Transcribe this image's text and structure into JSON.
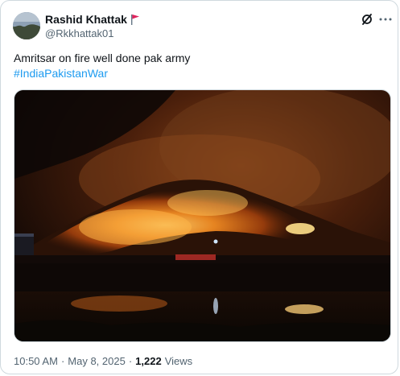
{
  "author": {
    "display_name": "Rashid Khattak",
    "handle": "@Rkkhattak01",
    "badge_icon": "red-flag-icon"
  },
  "header_actions": {
    "grok_icon": "grok-icon",
    "more_icon": "more-icon"
  },
  "tweet": {
    "text": "Amritsar on fire well done pak army",
    "hashtag": "#IndiaPakistanWar"
  },
  "media": {
    "description_icon": "photo"
  },
  "meta": {
    "time": "10:50 AM",
    "separator": "·",
    "date": "May 8, 2025",
    "views_count": "1,222",
    "views_label": "Views"
  },
  "colors": {
    "text_primary": "#0f1419",
    "text_secondary": "#536471",
    "link": "#1d9bf0",
    "border": "#cfd9de",
    "flag": "#e0245e"
  }
}
